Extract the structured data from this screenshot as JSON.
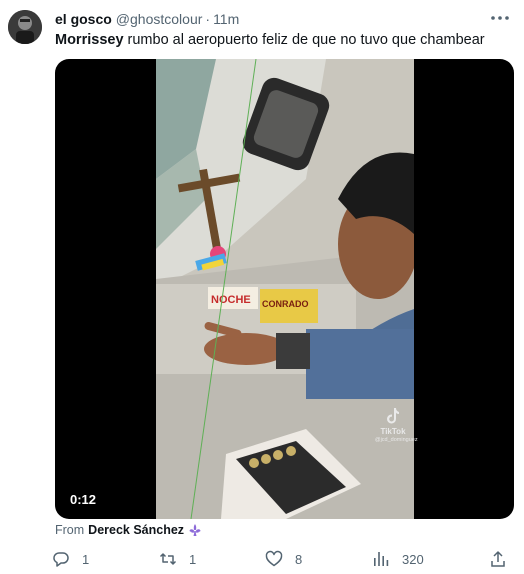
{
  "tweet": {
    "display_name": "el gosco",
    "handle": "@ghostcolour",
    "separator": "·",
    "time": "11m",
    "text_mention": "Morrissey",
    "text_rest": " rumbo al aeropuerto feliz de que no tuvo que chambear"
  },
  "media": {
    "duration": "0:12",
    "watermark": "TikTok",
    "watermark_user": "@jcd_dominguez",
    "sign_text_1": "NOCHE",
    "sign_text_2": "CONRADO"
  },
  "source": {
    "label": "From",
    "name": "Dereck Sánchez",
    "badge_icon": "fleur-de-lis-icon"
  },
  "actions": {
    "reply_count": "1",
    "retweet_count": "1",
    "like_count": "8",
    "views_count": "320"
  },
  "colors": {
    "text": "#0f1419",
    "muted": "#536471",
    "badge": "#8c6ad8"
  }
}
